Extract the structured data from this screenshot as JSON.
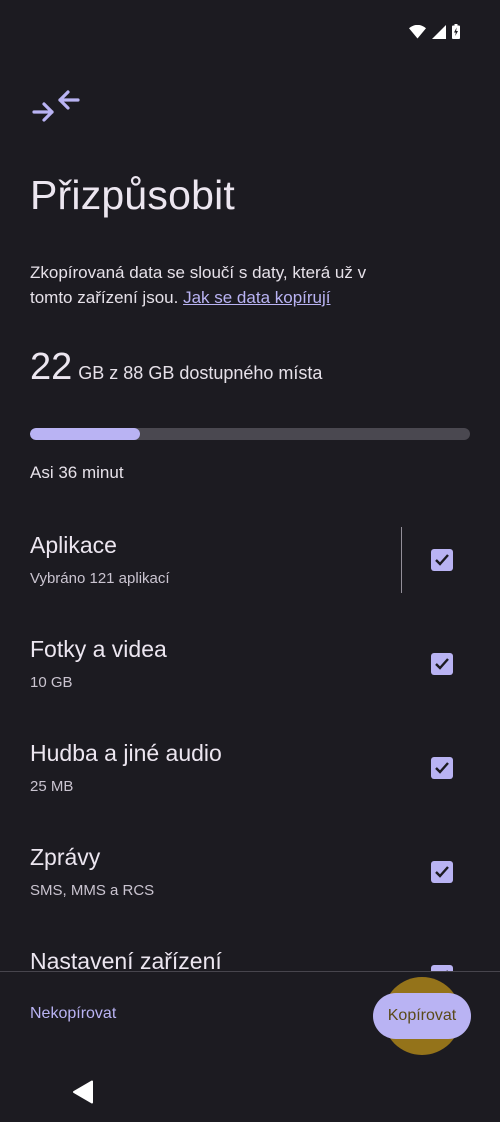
{
  "status_bar": {
    "icons": [
      "wifi-icon",
      "signal-icon",
      "battery-charging-icon"
    ]
  },
  "header": {
    "icon": "merge-arrows-icon",
    "title": "Přizpůsobit"
  },
  "description": {
    "text": "Zkopírovaná data se sloučí s daty, která už v tomto zařízení jsou.",
    "link": "Jak se data kopírují"
  },
  "storage": {
    "selected": "22",
    "text": "GB z 88 GB dostupného místa",
    "progress": 0.25
  },
  "estimate": "Asi 36 minut",
  "items": [
    {
      "title": "Aplikace",
      "subtitle": "Vybráno 121 aplikací",
      "checked": true
    },
    {
      "title": "Fotky a videa",
      "subtitle": "10 GB",
      "checked": true
    },
    {
      "title": "Hudba a jiné audio",
      "subtitle": "25 MB",
      "checked": true
    },
    {
      "title": "Zprávy",
      "subtitle": "SMS, MMS a RCS",
      "checked": true
    },
    {
      "title": "Nastavení zařízení",
      "subtitle": "",
      "checked": true
    }
  ],
  "footer": {
    "skip_label": "Nekopírovat",
    "copy_label": "Kopírovat"
  },
  "nav": {
    "back_icon": "back-triangle-icon"
  },
  "colors": {
    "background": "#1c1b21",
    "accent": "#b9b3f3",
    "touch": "#c49618"
  }
}
